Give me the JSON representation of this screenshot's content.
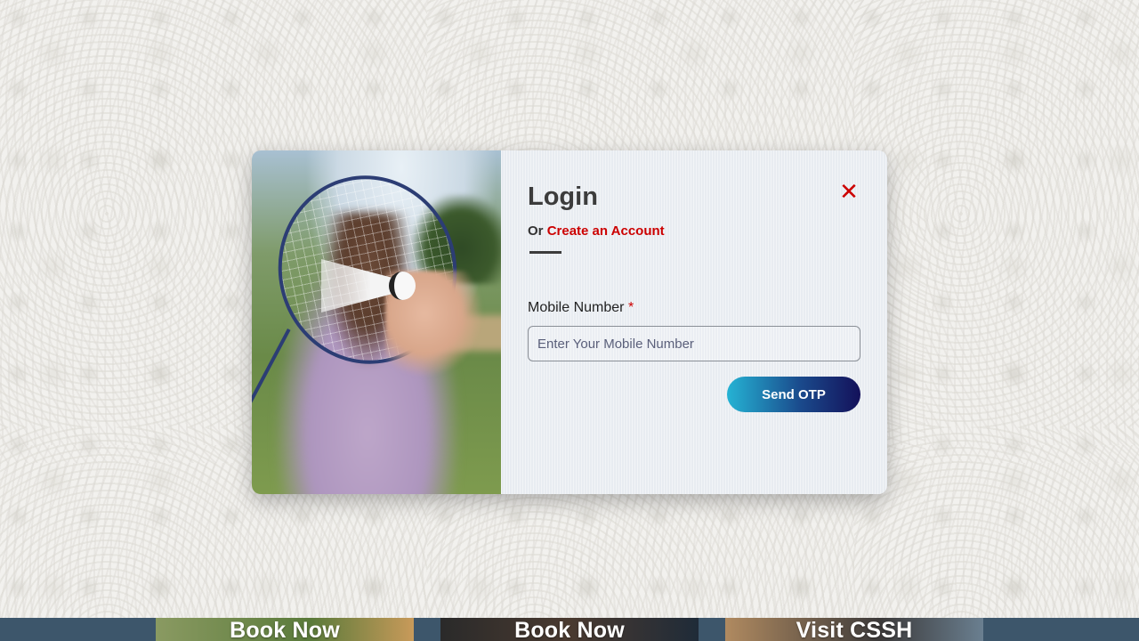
{
  "modal": {
    "title": "Login",
    "or_text": "Or",
    "create_account_link": "Create an Account",
    "close_symbol": "✕",
    "mobile_label": "Mobile Number",
    "required_mark": "*",
    "mobile_placeholder": "Enter Your Mobile Number",
    "mobile_value": "",
    "send_otp_label": "Send OTP",
    "image_subject": "badminton-player-image"
  },
  "bottom_strip": {
    "cards": [
      {
        "label": "Book Now"
      },
      {
        "label": "Book Now"
      },
      {
        "label": "Visit CSSH"
      }
    ]
  },
  "colors": {
    "accent_red": "#cc0000",
    "button_gradient_start": "#25b3d4",
    "button_gradient_end": "#14115a",
    "title_text": "#3c3c3c"
  }
}
